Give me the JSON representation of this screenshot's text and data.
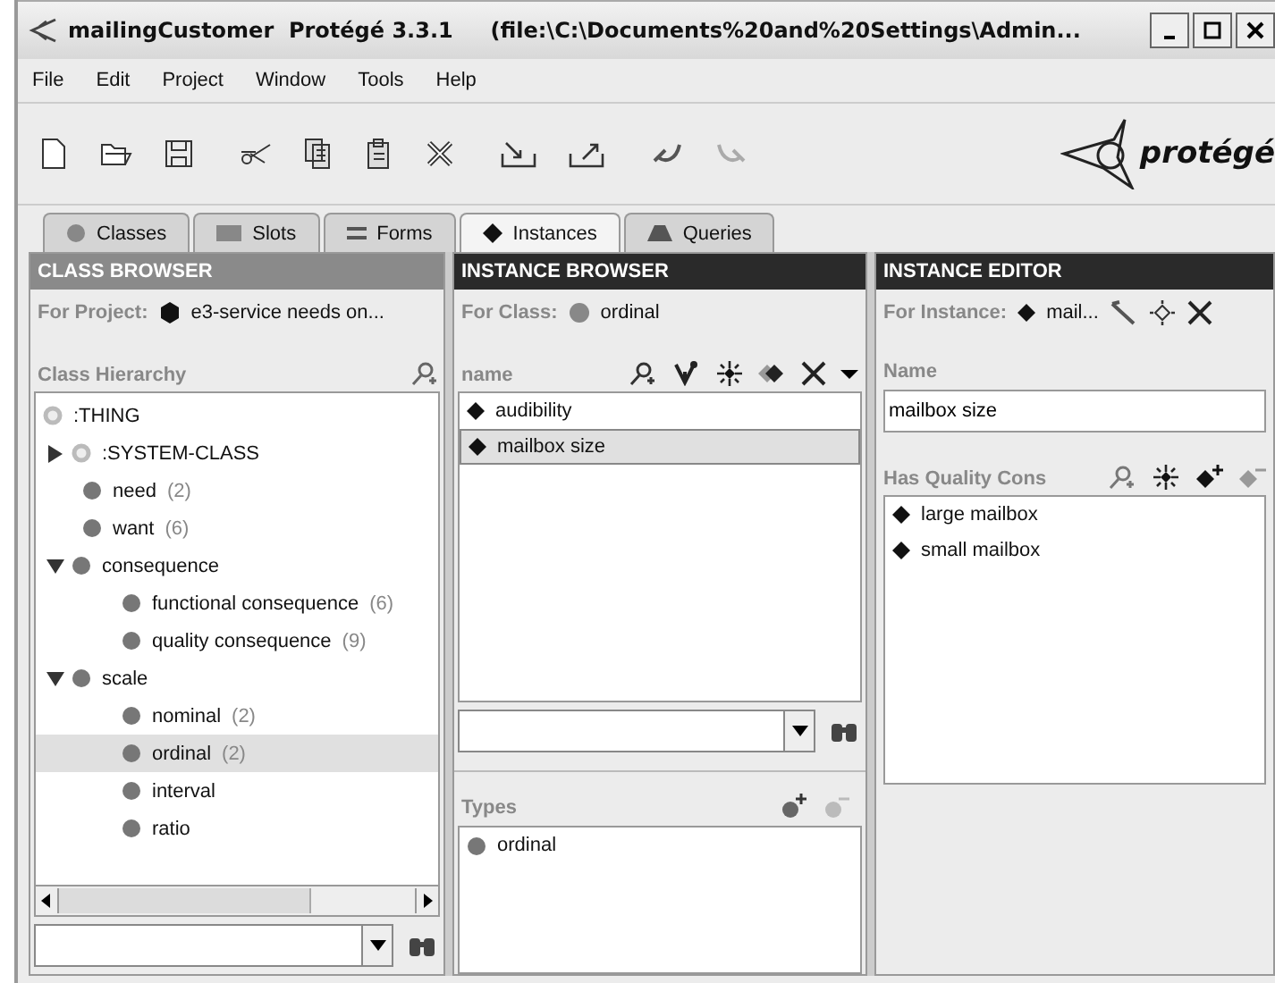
{
  "window": {
    "title": "mailingCustomer  Protégé 3.3.1     (file:\\C:\\Documents%20and%20Settings\\Admin..."
  },
  "menu": [
    "File",
    "Edit",
    "Project",
    "Window",
    "Tools",
    "Help"
  ],
  "logo": {
    "text": "protégé"
  },
  "tabs": [
    {
      "label": "Classes",
      "selected": false
    },
    {
      "label": "Slots",
      "selected": false
    },
    {
      "label": "Forms",
      "selected": false
    },
    {
      "label": "Instances",
      "selected": true
    },
    {
      "label": "Queries",
      "selected": false
    }
  ],
  "class_browser": {
    "title": "CLASS BROWSER",
    "focused": false,
    "for_label": "For Project:",
    "for_value": "e3-service needs on...",
    "hierarchy_label": "Class Hierarchy",
    "tree": [
      {
        "label": ":THING",
        "kind": "system",
        "selected": false,
        "children": [
          {
            "label": ":SYSTEM-CLASS",
            "kind": "system",
            "selected": false,
            "expanded": false
          },
          {
            "label": "need",
            "count": "(2)",
            "kind": "class",
            "selected": false
          },
          {
            "label": "want",
            "count": "(6)",
            "kind": "class",
            "selected": false
          },
          {
            "label": "consequence",
            "kind": "class",
            "selected": false,
            "expanded": true,
            "children": [
              {
                "label": "functional consequence",
                "count": "(6)",
                "kind": "class",
                "selected": false
              },
              {
                "label": "quality consequence",
                "count": "(9)",
                "kind": "class",
                "selected": false
              }
            ]
          },
          {
            "label": "scale",
            "kind": "class",
            "selected": false,
            "expanded": true,
            "children": [
              {
                "label": "nominal",
                "count": "(2)",
                "kind": "class",
                "selected": false
              },
              {
                "label": "ordinal",
                "count": "(2)",
                "kind": "class",
                "selected": true
              },
              {
                "label": "interval",
                "kind": "class",
                "selected": false
              },
              {
                "label": "ratio",
                "kind": "class",
                "selected": false
              }
            ]
          }
        ]
      }
    ]
  },
  "instance_browser": {
    "title": "INSTANCE BROWSER",
    "focused": true,
    "for_label": "For Class:",
    "for_value": "ordinal",
    "column_label": "name",
    "instances": [
      {
        "label": "audibility",
        "selected": false
      },
      {
        "label": "mailbox size",
        "selected": true
      }
    ],
    "types_label": "Types",
    "types": [
      "ordinal"
    ]
  },
  "instance_editor": {
    "title": "INSTANCE EDITOR",
    "focused": true,
    "for_label": "For Instance:",
    "for_value": "mail...",
    "name_label": "Name",
    "name_value": "mailbox size",
    "slot_label": "Has Quality Cons",
    "values": [
      "large mailbox",
      "small mailbox"
    ]
  }
}
